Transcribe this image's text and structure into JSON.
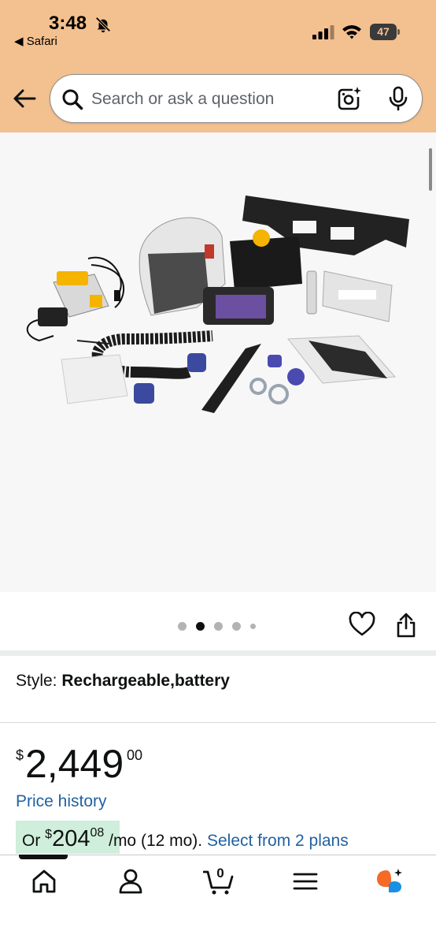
{
  "status_bar": {
    "time": "3:48",
    "back_app": "◀ Safari",
    "battery": "47",
    "icons": [
      "bell-slash-icon",
      "signal-icon",
      "wifi-icon",
      "battery-icon"
    ]
  },
  "search": {
    "placeholder": "Search or ask a question",
    "icons": [
      "back-arrow-icon",
      "search-icon",
      "camera-lens-icon",
      "microphone-icon"
    ]
  },
  "gallery": {
    "image_count": 5,
    "active_index": 1
  },
  "style": {
    "label": "Style:",
    "value": "Rechargeable,battery"
  },
  "price": {
    "symbol": "$",
    "whole": "2,449",
    "fraction": "00"
  },
  "price_history_label": "Price history",
  "monthly": {
    "prefix": "Or",
    "symbol": "$",
    "whole": "204",
    "fraction": "08",
    "suffix": "/mo (12 mo).",
    "link": "Select from 2 plans"
  },
  "tabbar": {
    "cart_count": "0",
    "icons": [
      "home-icon",
      "account-icon",
      "cart-icon",
      "menu-icon",
      "rufus-assistant-icon"
    ]
  },
  "colors": {
    "header_bg": "#f3c08f",
    "link": "#2162a1",
    "monthly_highlight": "#cfeedb",
    "assistant_orange": "#f56a26",
    "assistant_blue": "#1a8fe3"
  }
}
